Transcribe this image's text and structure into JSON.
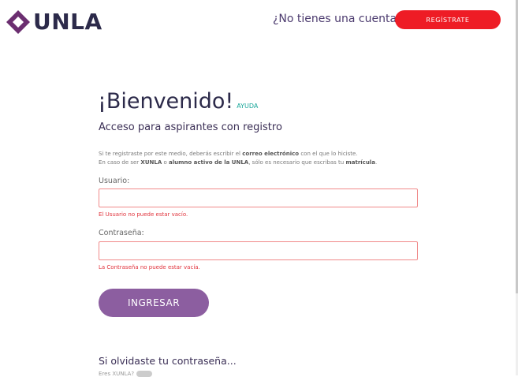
{
  "header": {
    "logo_text": "UNLA",
    "no_account_text": "¿No tienes una cuenta?",
    "register_label": "REGÍSTRATE"
  },
  "main": {
    "title": "¡Bienvenido!",
    "help_link": "AYUDA",
    "subtitle": "Acceso para aspirantes con registro",
    "info_line1_a": "Si te registraste por este medio, deberás escribir el ",
    "info_line1_b": "correo electrónico",
    "info_line1_c": " con el que lo hiciste.",
    "info_line2_a": "En caso de ser ",
    "info_line2_b": "XUNLA",
    "info_line2_c": " o ",
    "info_line2_d": "alumno activo de la UNLA",
    "info_line2_e": ", sólo es necesario que escribas tu ",
    "info_line2_f": "matrícula",
    "info_line2_g": ".",
    "user_label": "Usuario:",
    "user_value": "",
    "user_error": "El Usuario no puede estar vacío.",
    "password_label": "Contraseña:",
    "password_value": "",
    "password_error": "La Contraseña no puede estar vacía.",
    "submit_label": "INGRESAR",
    "forgot_title": "Si olvidaste tu contraseña...",
    "switch_label": "Eres XUNLA?"
  },
  "colors": {
    "primary": "#8c5ea0",
    "register": "#ee1c25",
    "error": "#e0323b",
    "help": "#1aa79a"
  }
}
